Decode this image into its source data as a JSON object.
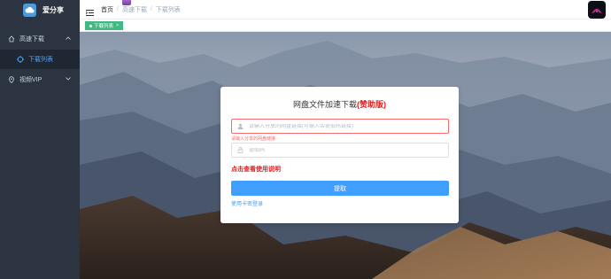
{
  "sidebar": {
    "logo_text": "爱分享",
    "menu": [
      {
        "label": "高速下载",
        "icon": "home-icon",
        "expanded": true
      },
      {
        "label": "视频VIP",
        "icon": "location-icon",
        "expanded": false
      }
    ],
    "sub_items": [
      {
        "label": "下载列表",
        "icon": "target-icon",
        "active": true
      }
    ]
  },
  "header": {
    "breadcrumb": [
      "首页",
      "高速下载",
      "下载列表"
    ]
  },
  "tags": [
    {
      "label": "下载列表",
      "active": true
    }
  ],
  "card": {
    "title_main": "网盘文件加速下载",
    "title_highlight": "(赞助版)",
    "link_input": {
      "placeholder": "请输入分享的网盘链接(可输入带提取码链接)",
      "value": "",
      "error": "请输入分享的网盘链接"
    },
    "code_input": {
      "placeholder": "提取码",
      "value": ""
    },
    "help_text": "点击查看使用说明",
    "submit_label": "提取",
    "card_login_text": "使用卡密登录"
  },
  "colors": {
    "sidebar_bg": "#2b3440",
    "accent": "#409eff",
    "tag_active": "#42b983",
    "highlight_red": "#e02020",
    "error_red": "#f56c6c"
  }
}
